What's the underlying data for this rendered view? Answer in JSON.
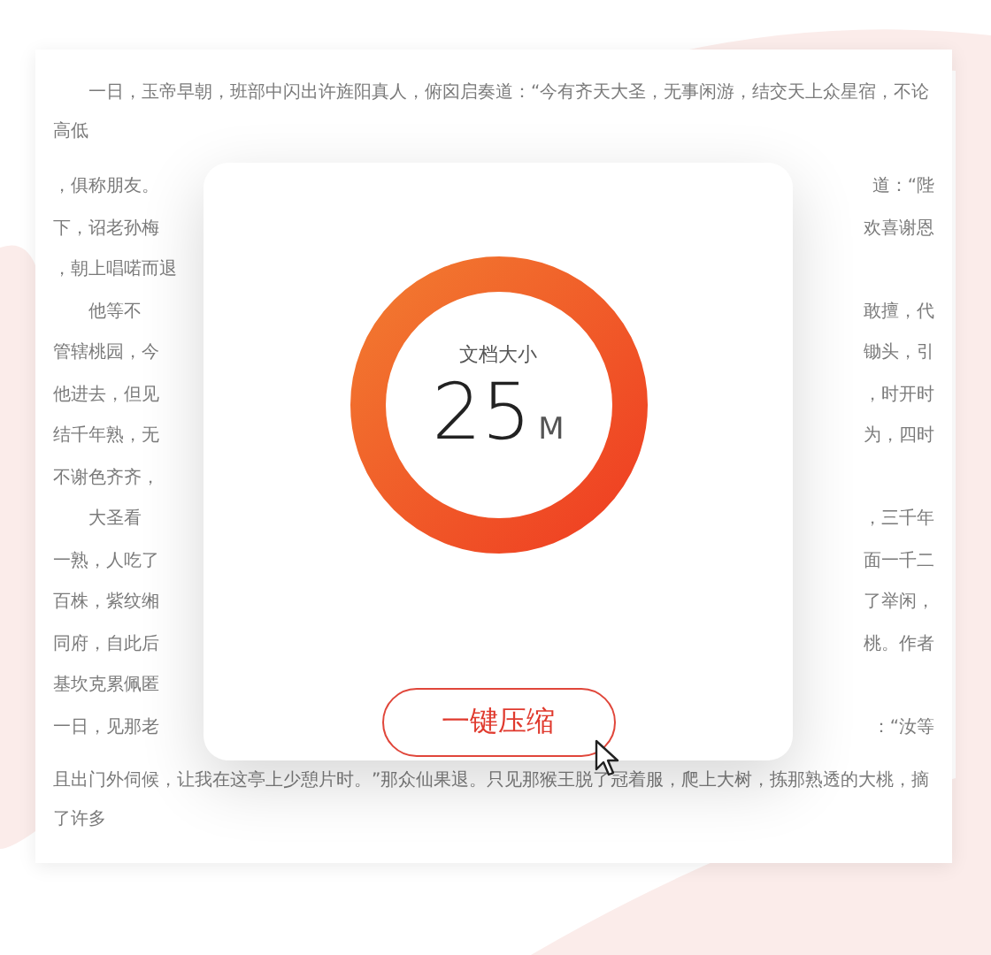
{
  "document": {
    "lines": [
      {
        "indent": true,
        "segments": [
          "一日，玉帝早朝，班部中闪出许旌阳真人，俯囟启奏道：“今有齐天大圣，无事闲游，结交天上众星宿，不论高低"
        ]
      },
      {
        "indent": false,
        "segments": [
          "，俱称朋友。",
          "道：“陛"
        ]
      },
      {
        "indent": false,
        "segments": [
          "下，诏老孙梅",
          "欢喜谢恩"
        ]
      },
      {
        "indent": false,
        "segments": [
          "，朝上唱喏而退"
        ]
      },
      {
        "indent": true,
        "segments": [
          "他等不",
          "敢擅，代"
        ]
      },
      {
        "indent": false,
        "segments": [
          "管辖桃园，今",
          "锄头，引"
        ]
      },
      {
        "indent": false,
        "segments": [
          "他进去，但见",
          "，时开时"
        ]
      },
      {
        "indent": false,
        "segments": [
          "结千年熟，无",
          "为，四时"
        ]
      },
      {
        "indent": false,
        "segments": [
          "不谢色齐齐，"
        ]
      },
      {
        "indent": true,
        "segments": [
          "大圣看",
          "，三千年"
        ]
      },
      {
        "indent": false,
        "segments": [
          "一熟，人吃了",
          "面一千二"
        ]
      },
      {
        "indent": false,
        "segments": [
          "百株，紫纹缃",
          "了举闲，"
        ]
      },
      {
        "indent": false,
        "segments": [
          "同府，自此后",
          "桃。作者"
        ]
      },
      {
        "indent": false,
        "segments": [
          "基坎克累佩匿"
        ]
      },
      {
        "indent": false,
        "segments": [
          "一日，见那老",
          "：“汝等"
        ]
      },
      {
        "indent": false,
        "segments": [
          "且出门外伺候，让我在这亭上少憩片时。”那众仙果退。只见那猴王脱了冠着服，爬上大树，拣那熟透的大桃，摘了许多"
        ]
      }
    ]
  },
  "dialog": {
    "label": "文档大小",
    "size": "25",
    "unit": "M",
    "button": "一键压缩"
  }
}
